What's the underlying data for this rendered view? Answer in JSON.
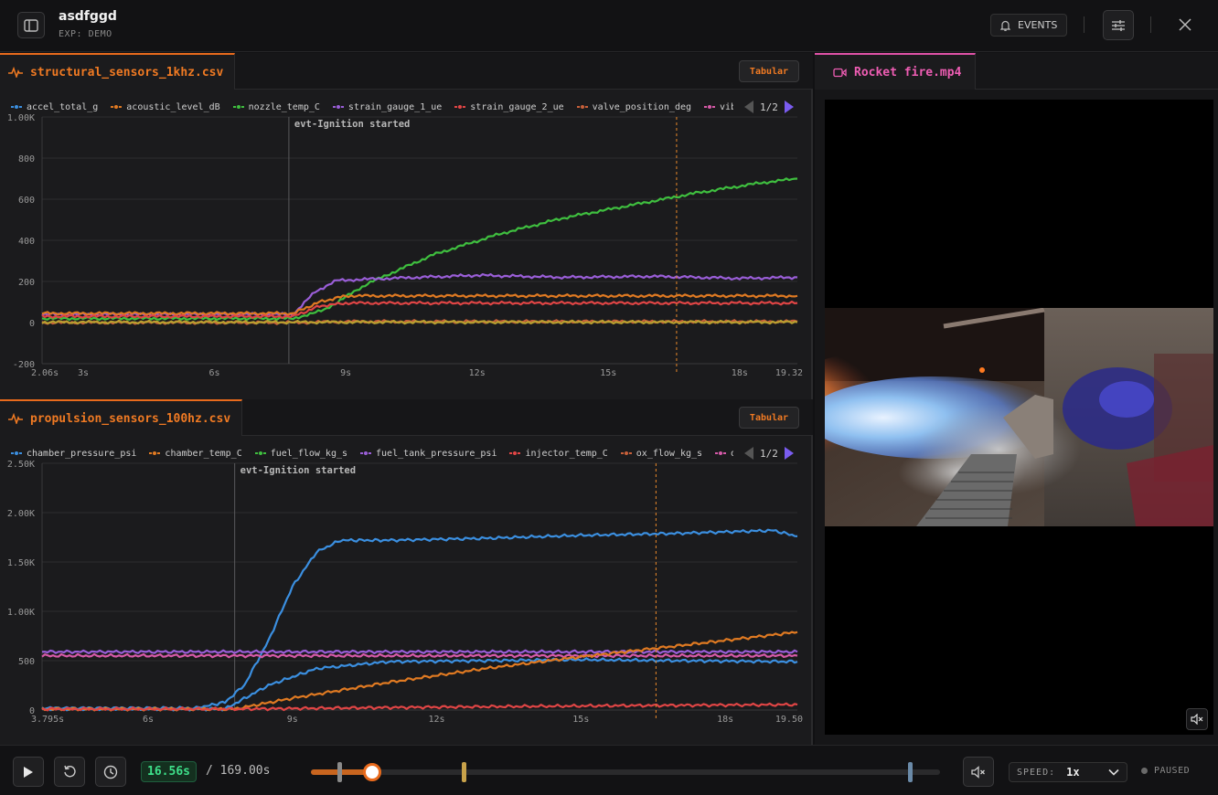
{
  "header": {
    "title": "asdfggd",
    "subtitle": "EXP: DEMO",
    "events_label": "EVENTS"
  },
  "panels": [
    {
      "tab_label": "structural_sensors_1khz.csv",
      "tabular_label": "Tabular",
      "legend": [
        {
          "name": "accel_total_g",
          "color": "#3b8fe0"
        },
        {
          "name": "acoustic_level_dB",
          "color": "#e07a22"
        },
        {
          "name": "nozzle_temp_C",
          "color": "#3fbf3f"
        },
        {
          "name": "strain_gauge_1_ue",
          "color": "#9a5ed8"
        },
        {
          "name": "strain_gauge_2_ue",
          "color": "#e04545"
        },
        {
          "name": "valve_position_deg",
          "color": "#c8603a"
        },
        {
          "name": "vibration_",
          "color": "#d65aa8"
        }
      ],
      "page": "1/2",
      "event_label": "evt-Ignition started",
      "y_ticks": [
        "1.00K",
        "800",
        "600",
        "400",
        "200",
        "0",
        "-200"
      ],
      "x_ticks": [
        "2.06s",
        "3s",
        "6s",
        "9s",
        "12s",
        "15s",
        "18s",
        "19.32"
      ]
    },
    {
      "tab_label": "propulsion_sensors_100hz.csv",
      "tabular_label": "Tabular",
      "legend": [
        {
          "name": "chamber_pressure_psi",
          "color": "#3b8fe0"
        },
        {
          "name": "chamber_temp_C",
          "color": "#e07a22"
        },
        {
          "name": "fuel_flow_kg_s",
          "color": "#3fbf3f"
        },
        {
          "name": "fuel_tank_pressure_psi",
          "color": "#9a5ed8"
        },
        {
          "name": "injector_temp_C",
          "color": "#e04545"
        },
        {
          "name": "ox_flow_kg_s",
          "color": "#c8603a"
        },
        {
          "name": "ox_tank_",
          "color": "#d65aa8"
        }
      ],
      "page": "1/2",
      "event_label": "evt-Ignition started",
      "y_ticks": [
        "2.50K",
        "2.00K",
        "1.50K",
        "1.00K",
        "500",
        "0"
      ],
      "x_ticks": [
        "3.795s",
        "6s",
        "9s",
        "12s",
        "15s",
        "18s",
        "19.50"
      ]
    }
  ],
  "chart_data": [
    {
      "type": "line",
      "x_range": [
        2.06,
        19.32
      ],
      "ylim": [
        -200,
        1000
      ],
      "event_x": 7.7,
      "cursor_x": 16.56,
      "series": [
        {
          "name": "nozzle_temp_C",
          "color": "#3fbf3f",
          "x": [
            2.06,
            7.8,
            8.5,
            9.5,
            11,
            12.5,
            14,
            15.5,
            17,
            18.5,
            19.32
          ],
          "y": [
            20,
            20,
            60,
            190,
            330,
            430,
            510,
            570,
            630,
            680,
            700
          ]
        },
        {
          "name": "strain_gauge_1_ue",
          "color": "#9a5ed8",
          "x": [
            2.06,
            7.8,
            8.3,
            8.8,
            10,
            12,
            14,
            16,
            18,
            19.32
          ],
          "y": [
            40,
            40,
            150,
            205,
            215,
            230,
            220,
            225,
            215,
            220
          ]
        },
        {
          "name": "acoustic_level_dB",
          "color": "#e07a22",
          "x": [
            2.06,
            7.8,
            8.4,
            9.0,
            12,
            15,
            18,
            19.32
          ],
          "y": [
            45,
            45,
            100,
            130,
            130,
            130,
            130,
            130
          ]
        },
        {
          "name": "strain_gauge_2_ue",
          "color": "#e04545",
          "x": [
            2.06,
            7.8,
            8.4,
            9.0,
            12,
            15,
            19.32
          ],
          "y": [
            30,
            30,
            80,
            95,
            95,
            95,
            95
          ]
        },
        {
          "name": "valve_position_deg",
          "color": "#c8603a",
          "x": [
            2.06,
            7.8,
            9,
            19.32
          ],
          "y": [
            0,
            0,
            5,
            5
          ]
        },
        {
          "name": "accel_total_g",
          "color": "#b8a030",
          "x": [
            2.06,
            19.32
          ],
          "y": [
            2,
            2
          ]
        }
      ]
    },
    {
      "type": "line",
      "x_range": [
        3.795,
        19.5
      ],
      "ylim": [
        0,
        2500
      ],
      "event_x": 7.8,
      "cursor_x": 16.56,
      "series": [
        {
          "name": "chamber_pressure_psi",
          "color": "#3b8fe0",
          "x": [
            3.795,
            7.0,
            7.6,
            8.0,
            8.5,
            9.0,
            9.5,
            10.0,
            11,
            13,
            15,
            17,
            19,
            19.5
          ],
          "y": [
            20,
            20,
            80,
            250,
            700,
            1250,
            1600,
            1720,
            1720,
            1740,
            1770,
            1790,
            1820,
            1760
          ]
        },
        {
          "name": "fuel_tank_pressure_psi",
          "color": "#9a5ed8",
          "x": [
            3.795,
            19.5
          ],
          "y": [
            590,
            590
          ]
        },
        {
          "name": "ox_tank_",
          "color": "#d65aa8",
          "x": [
            3.795,
            19.5
          ],
          "y": [
            550,
            550
          ]
        },
        {
          "name": "fuel_flow_kg_s",
          "color": "#3b8fe0",
          "x": [
            3.795,
            7.6,
            8.5,
            9.5,
            11,
            13,
            15,
            17,
            19.5
          ],
          "y": [
            10,
            10,
            250,
            420,
            490,
            500,
            510,
            500,
            490
          ]
        },
        {
          "name": "chamber_temp_C",
          "color": "#e07a22",
          "x": [
            3.795,
            7.8,
            9,
            11,
            13,
            15,
            17,
            19.5
          ],
          "y": [
            10,
            10,
            120,
            280,
            420,
            540,
            650,
            790
          ]
        },
        {
          "name": "injector_temp_C",
          "color": "#e04545",
          "x": [
            3.795,
            7.8,
            12,
            16,
            19.5
          ],
          "y": [
            10,
            10,
            30,
            45,
            55
          ]
        }
      ]
    }
  ],
  "video": {
    "tab_label": "Rocket fire.mp4"
  },
  "player": {
    "current_time": "16.56s",
    "total_time": "/ 169.00s",
    "progress": 0.098,
    "speed_label": "SPEED:",
    "speed_value": "1x",
    "status": "PAUSED"
  }
}
